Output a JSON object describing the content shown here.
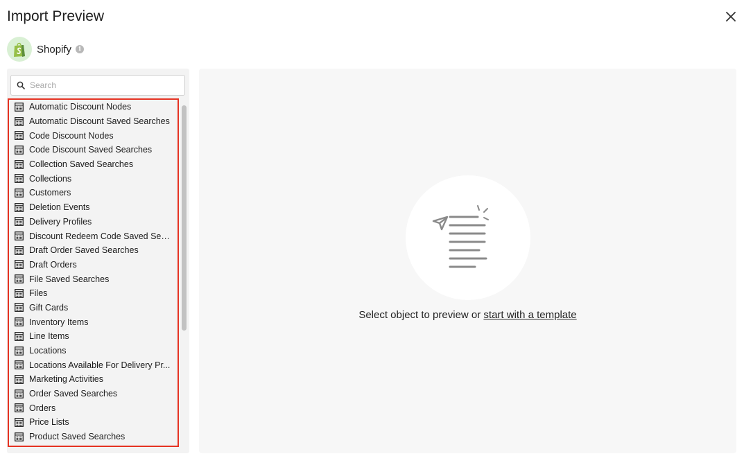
{
  "dialog": {
    "title": "Import Preview"
  },
  "source": {
    "name": "Shopify",
    "info_glyph": "i",
    "logo_color": "#95bf47"
  },
  "search": {
    "placeholder": "Search",
    "value": ""
  },
  "objects": [
    "Automatic Discount Nodes",
    "Automatic Discount Saved Searches",
    "Code Discount Nodes",
    "Code Discount Saved Searches",
    "Collection Saved Searches",
    "Collections",
    "Customers",
    "Deletion Events",
    "Delivery Profiles",
    "Discount Redeem Code Saved Sea...",
    "Draft Order Saved Searches",
    "Draft Orders",
    "File Saved Searches",
    "Files",
    "Gift Cards",
    "Inventory Items",
    "Line Items",
    "Locations",
    "Locations Available For Delivery Pr...",
    "Marketing Activities",
    "Order Saved Searches",
    "Orders",
    "Price Lists",
    "Product Saved Searches"
  ],
  "preview": {
    "message": "Select object to preview or ",
    "link_text": "start with a template"
  },
  "colors": {
    "highlight_border": "#e53222",
    "sidebar_bg": "#f3f3f3",
    "panel_bg": "#f7f7f7"
  }
}
